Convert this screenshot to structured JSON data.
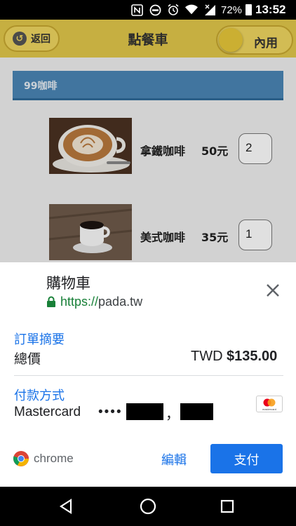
{
  "status_bar": {
    "icons": [
      "nfc-icon",
      "blocked-icon",
      "alarm-icon",
      "wifi-icon",
      "signal-icon"
    ],
    "battery_pct": "72%",
    "time": "13:52"
  },
  "app": {
    "back_label": "返回",
    "title": "點餐車",
    "dine_mode": "內用",
    "category": "99咖啡",
    "items": [
      {
        "name": "拿鐵咖啡",
        "price": "50元",
        "qty": "2"
      },
      {
        "name": "美式咖啡",
        "price": "35元",
        "qty": "1"
      }
    ]
  },
  "payment_sheet": {
    "title": "購物車",
    "url_protocol": "https://",
    "url_host": "pada.tw",
    "order_summary_label": "訂單摘要",
    "total_label": "總價",
    "currency": "TWD",
    "total_amount": "$135.00",
    "payment_method_label": "付款方式",
    "card_brand": "Mastercard",
    "card_mask": "••••",
    "card_separator": "，",
    "card_logo_text": "mastercard",
    "browser_name": "chrome",
    "edit_label": "編輯",
    "pay_label": "支付"
  },
  "colors": {
    "accent": "#1a73e8",
    "secure": "#188038",
    "topbar": "#e2c84a",
    "category_bar": "#4a86b5"
  }
}
